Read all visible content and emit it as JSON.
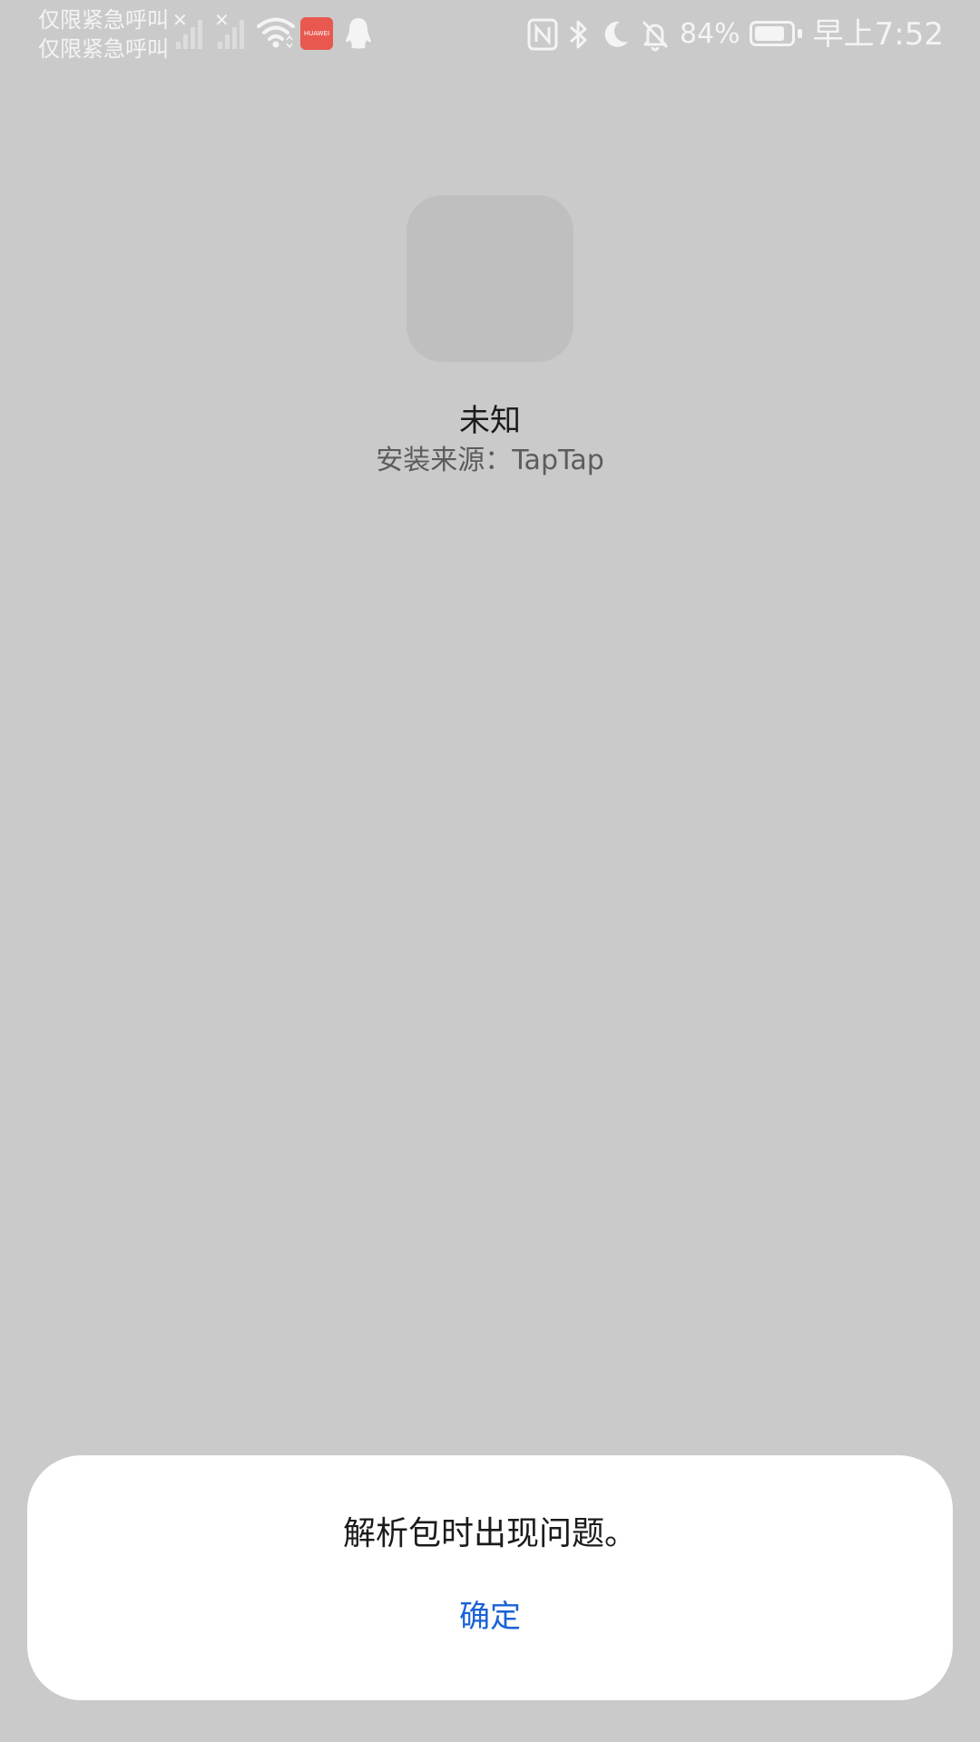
{
  "status_bar": {
    "carrier_line1": "仅限紧急呼叫",
    "carrier_line2": "仅限紧急呼叫",
    "sim1_icon": "signal-no-service-icon",
    "sim2_icon": "signal-no-service-icon",
    "wifi_icon": "wifi-icon",
    "huawei_icon_label": "HUAWEI",
    "qq_icon": "qq-penguin-icon",
    "nfc_icon": "nfc-icon",
    "bluetooth_icon": "bluetooth-icon",
    "moon_icon": "moon-icon",
    "mute_icon": "bell-off-icon",
    "battery_percent": "84%",
    "battery_level": 0.84,
    "clock": "早上7:52"
  },
  "app": {
    "name": "未知",
    "source": "安装来源：TapTap"
  },
  "dialog": {
    "message": "解析包时出现问题。",
    "confirm_label": "确定"
  },
  "colors": {
    "background": "#cacaca",
    "accent": "#1a62d6",
    "dialog_bg": "#ffffff",
    "huawei_badge": "#e8584f"
  }
}
